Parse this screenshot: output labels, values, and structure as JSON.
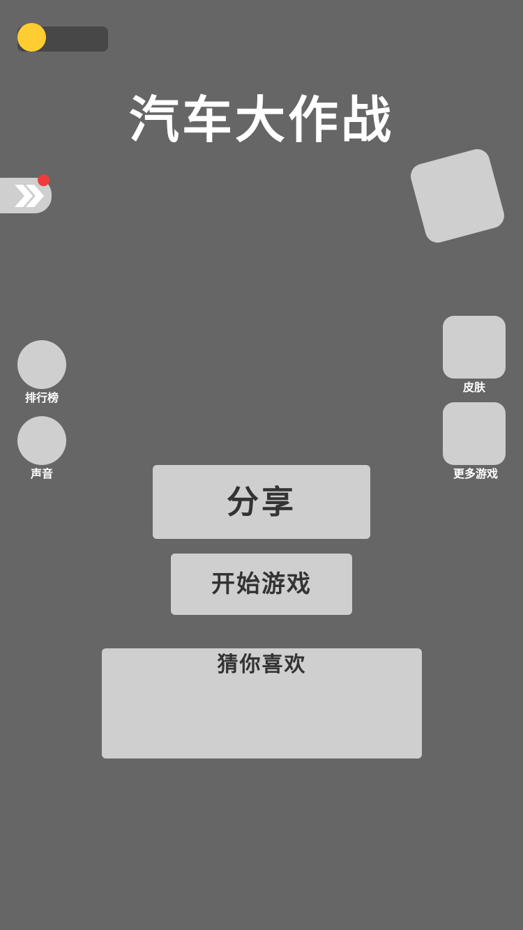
{
  "title": "汽车大作战",
  "left_buttons": {
    "rank_label": "排行榜",
    "sound_label": "声音"
  },
  "right_buttons": {
    "skin_label": "皮肤",
    "more_games_label": "更多游戏"
  },
  "actions": {
    "share_label": "分享",
    "start_label": "开始游戏"
  },
  "recommend": {
    "title": "猜你喜欢"
  },
  "colors": {
    "background": "#666666",
    "button": "#cfcfcf",
    "coin": "#fecd32",
    "badge": "#ee3c3c"
  },
  "icons": {
    "coin": "coin-icon",
    "side_tab": "double-chevron-right-icon"
  }
}
